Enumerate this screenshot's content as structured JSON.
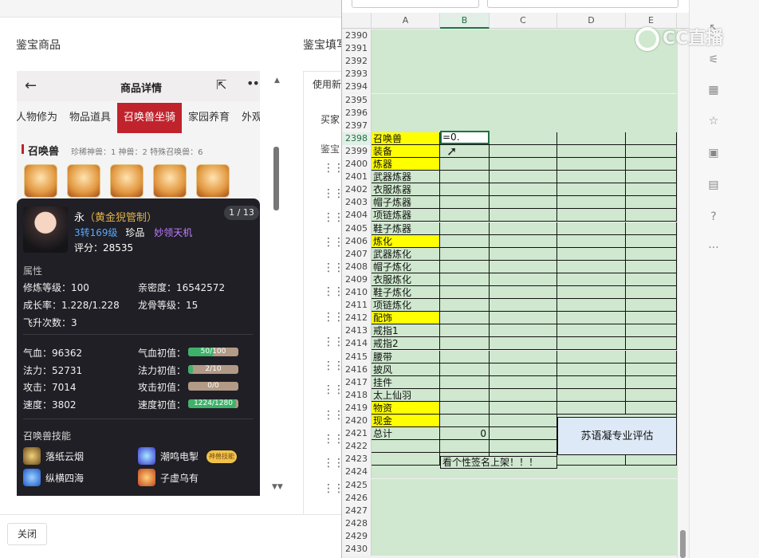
{
  "app": {
    "panel_title": "鉴宝商品",
    "panel_title2": "鉴宝填写",
    "close_label": "关闭"
  },
  "phone": {
    "title": "商品详情",
    "back_icon": "‹",
    "share_icon": "share-icon",
    "more_icon": "more-icon",
    "tabs": [
      "人物修为",
      "物品道具",
      "召唤兽坐骑",
      "家园养育",
      "外观"
    ],
    "active_tab": 2,
    "summon_heading": "召唤兽",
    "summon_stats": "珍稀神兽：1  神兽：2  特殊召唤兽：6"
  },
  "card": {
    "pager": "1 / 13",
    "name_main": "永",
    "name_tag": "（黄金猊管制）",
    "level": "3转169级",
    "quality": "珍品",
    "skill_tag": "妙领天机",
    "score": "评分：28535",
    "attr_title": "属性",
    "attrs": [
      "修炼等级：100",
      "亲密度：16542572",
      "成长率：1.228/1.228",
      "龙骨等级：15",
      "飞升次数：3"
    ],
    "stats": [
      {
        "label": "气血：96362",
        "init_label": "气血初值：",
        "bar_text": "50/100",
        "fill": 0.5
      },
      {
        "label": "法力：52731",
        "init_label": "法力初值：",
        "bar_text": "2/10",
        "fill": 0.1
      },
      {
        "label": "攻击：7014",
        "init_label": "攻击初值：",
        "bar_text": "0/0",
        "fill": 0
      },
      {
        "label": "速度：3802",
        "init_label": "速度初值：",
        "bar_text": "1224/1280",
        "fill": 0.95
      }
    ],
    "skills_title": "召唤兽技能",
    "skills": [
      "落纸云烟",
      "潮鸣电掣",
      "纵横四海",
      "子虚乌有"
    ],
    "badge": "神兽技能"
  },
  "middle": {
    "tab": "使用新",
    "tab2": "买家",
    "label": "鉴宝"
  },
  "sheet": {
    "columns": [
      "A",
      "B",
      "C",
      "D",
      "E"
    ],
    "rows": [
      {
        "n": "2390",
        "a": "",
        "style": "plain"
      },
      {
        "n": "2391",
        "a": "",
        "style": "plain"
      },
      {
        "n": "2392",
        "a": "",
        "style": "plain"
      },
      {
        "n": "2393",
        "a": "",
        "style": "plain"
      },
      {
        "n": "2394",
        "a": "",
        "style": "plain"
      },
      {
        "n": "2395",
        "a": "",
        "style": "plain"
      },
      {
        "n": "2396",
        "a": "",
        "style": "plain"
      },
      {
        "n": "2397",
        "a": "",
        "style": "plain"
      },
      {
        "n": "2398",
        "a": "召唤兽",
        "style": "yellow"
      },
      {
        "n": "2399",
        "a": "装备",
        "style": "yellow"
      },
      {
        "n": "2400",
        "a": "炼器",
        "style": "yellow"
      },
      {
        "n": "2401",
        "a": "武器炼器",
        "style": "box"
      },
      {
        "n": "2402",
        "a": "衣服炼器",
        "style": "box"
      },
      {
        "n": "2403",
        "a": "帽子炼器",
        "style": "box"
      },
      {
        "n": "2404",
        "a": "项链炼器",
        "style": "box"
      },
      {
        "n": "2405",
        "a": "鞋子炼器",
        "style": "box"
      },
      {
        "n": "2406",
        "a": "炼化",
        "style": "yellow"
      },
      {
        "n": "2407",
        "a": "武器炼化",
        "style": "box"
      },
      {
        "n": "2408",
        "a": "帽子炼化",
        "style": "box"
      },
      {
        "n": "2409",
        "a": "衣服炼化",
        "style": "box"
      },
      {
        "n": "2410",
        "a": "鞋子炼化",
        "style": "box"
      },
      {
        "n": "2411",
        "a": "项链炼化",
        "style": "box"
      },
      {
        "n": "2412",
        "a": "配饰",
        "style": "yellow"
      },
      {
        "n": "2413",
        "a": "戒指1",
        "style": "box"
      },
      {
        "n": "2414",
        "a": "戒指2",
        "style": "box"
      },
      {
        "n": "2415",
        "a": "腰带",
        "style": "box"
      },
      {
        "n": "2416",
        "a": "披风",
        "style": "box"
      },
      {
        "n": "2417",
        "a": "挂件",
        "style": "box"
      },
      {
        "n": "2418",
        "a": "太上仙羽",
        "style": "box"
      },
      {
        "n": "2419",
        "a": "物资",
        "style": "yellow"
      },
      {
        "n": "2420",
        "a": "现金",
        "style": "yellow"
      },
      {
        "n": "2421",
        "a": "总计",
        "style": "total"
      },
      {
        "n": "2422",
        "a": "",
        "style": "plainbox"
      },
      {
        "n": "2423",
        "a": "",
        "style": "plainbox"
      },
      {
        "n": "2424",
        "a": "",
        "style": "plain"
      },
      {
        "n": "2425",
        "a": "",
        "style": "plain"
      },
      {
        "n": "2426",
        "a": "",
        "style": "plain"
      },
      {
        "n": "2427",
        "a": "",
        "style": "plain"
      },
      {
        "n": "2428",
        "a": "",
        "style": "plain"
      },
      {
        "n": "2429",
        "a": "",
        "style": "plain"
      },
      {
        "n": "2430",
        "a": "",
        "style": "plain"
      }
    ],
    "active_cell_value": "=0.",
    "total_value": "0",
    "merged_text": "苏语凝专业评估",
    "banner_text": "看个性签名上架！！！"
  },
  "watermark": "CC直播",
  "colors": {
    "accent": "#c0232c",
    "sheet_green": "#cfe8cf",
    "yellow": "#ffff00",
    "excel_green": "#1e7145"
  }
}
